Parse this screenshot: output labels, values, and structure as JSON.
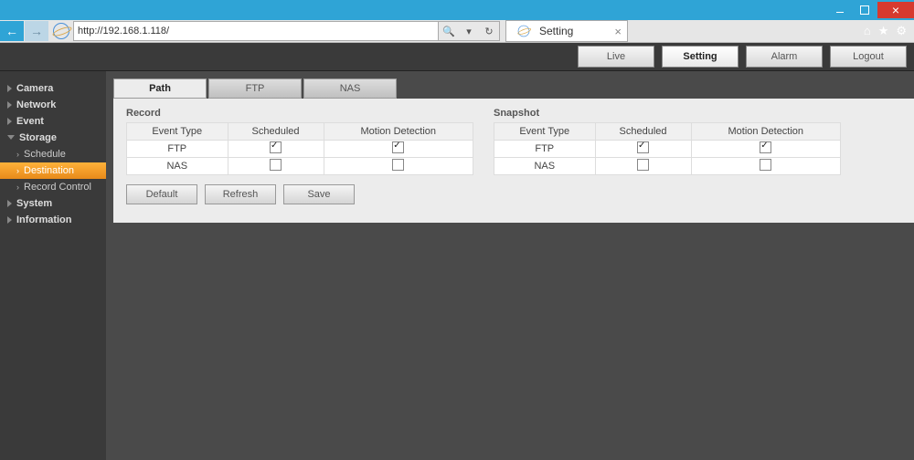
{
  "browser": {
    "url": "http://192.168.1.118/",
    "tab_title": "Setting",
    "icons": {
      "home": "⌂",
      "star": "★",
      "gear": "⚙"
    }
  },
  "topnav": {
    "live": "Live",
    "setting": "Setting",
    "alarm": "Alarm",
    "logout": "Logout",
    "active": "setting"
  },
  "sidebar": {
    "camera": "Camera",
    "network": "Network",
    "event": "Event",
    "storage": "Storage",
    "schedule": "Schedule",
    "destination": "Destination",
    "record_control": "Record Control",
    "system": "System",
    "information": "Information"
  },
  "tabs": {
    "path": "Path",
    "ftp": "FTP",
    "nas": "NAS",
    "active": "path"
  },
  "panel": {
    "record": {
      "title": "Record",
      "headers": [
        "Event Type",
        "Scheduled",
        "Motion Detection"
      ],
      "rows": [
        {
          "label": "FTP",
          "scheduled": true,
          "motion": true
        },
        {
          "label": "NAS",
          "scheduled": false,
          "motion": false
        }
      ]
    },
    "snapshot": {
      "title": "Snapshot",
      "headers": [
        "Event Type",
        "Scheduled",
        "Motion Detection"
      ],
      "rows": [
        {
          "label": "FTP",
          "scheduled": true,
          "motion": true
        },
        {
          "label": "NAS",
          "scheduled": false,
          "motion": false
        }
      ]
    },
    "buttons": {
      "default": "Default",
      "refresh": "Refresh",
      "save": "Save"
    }
  }
}
